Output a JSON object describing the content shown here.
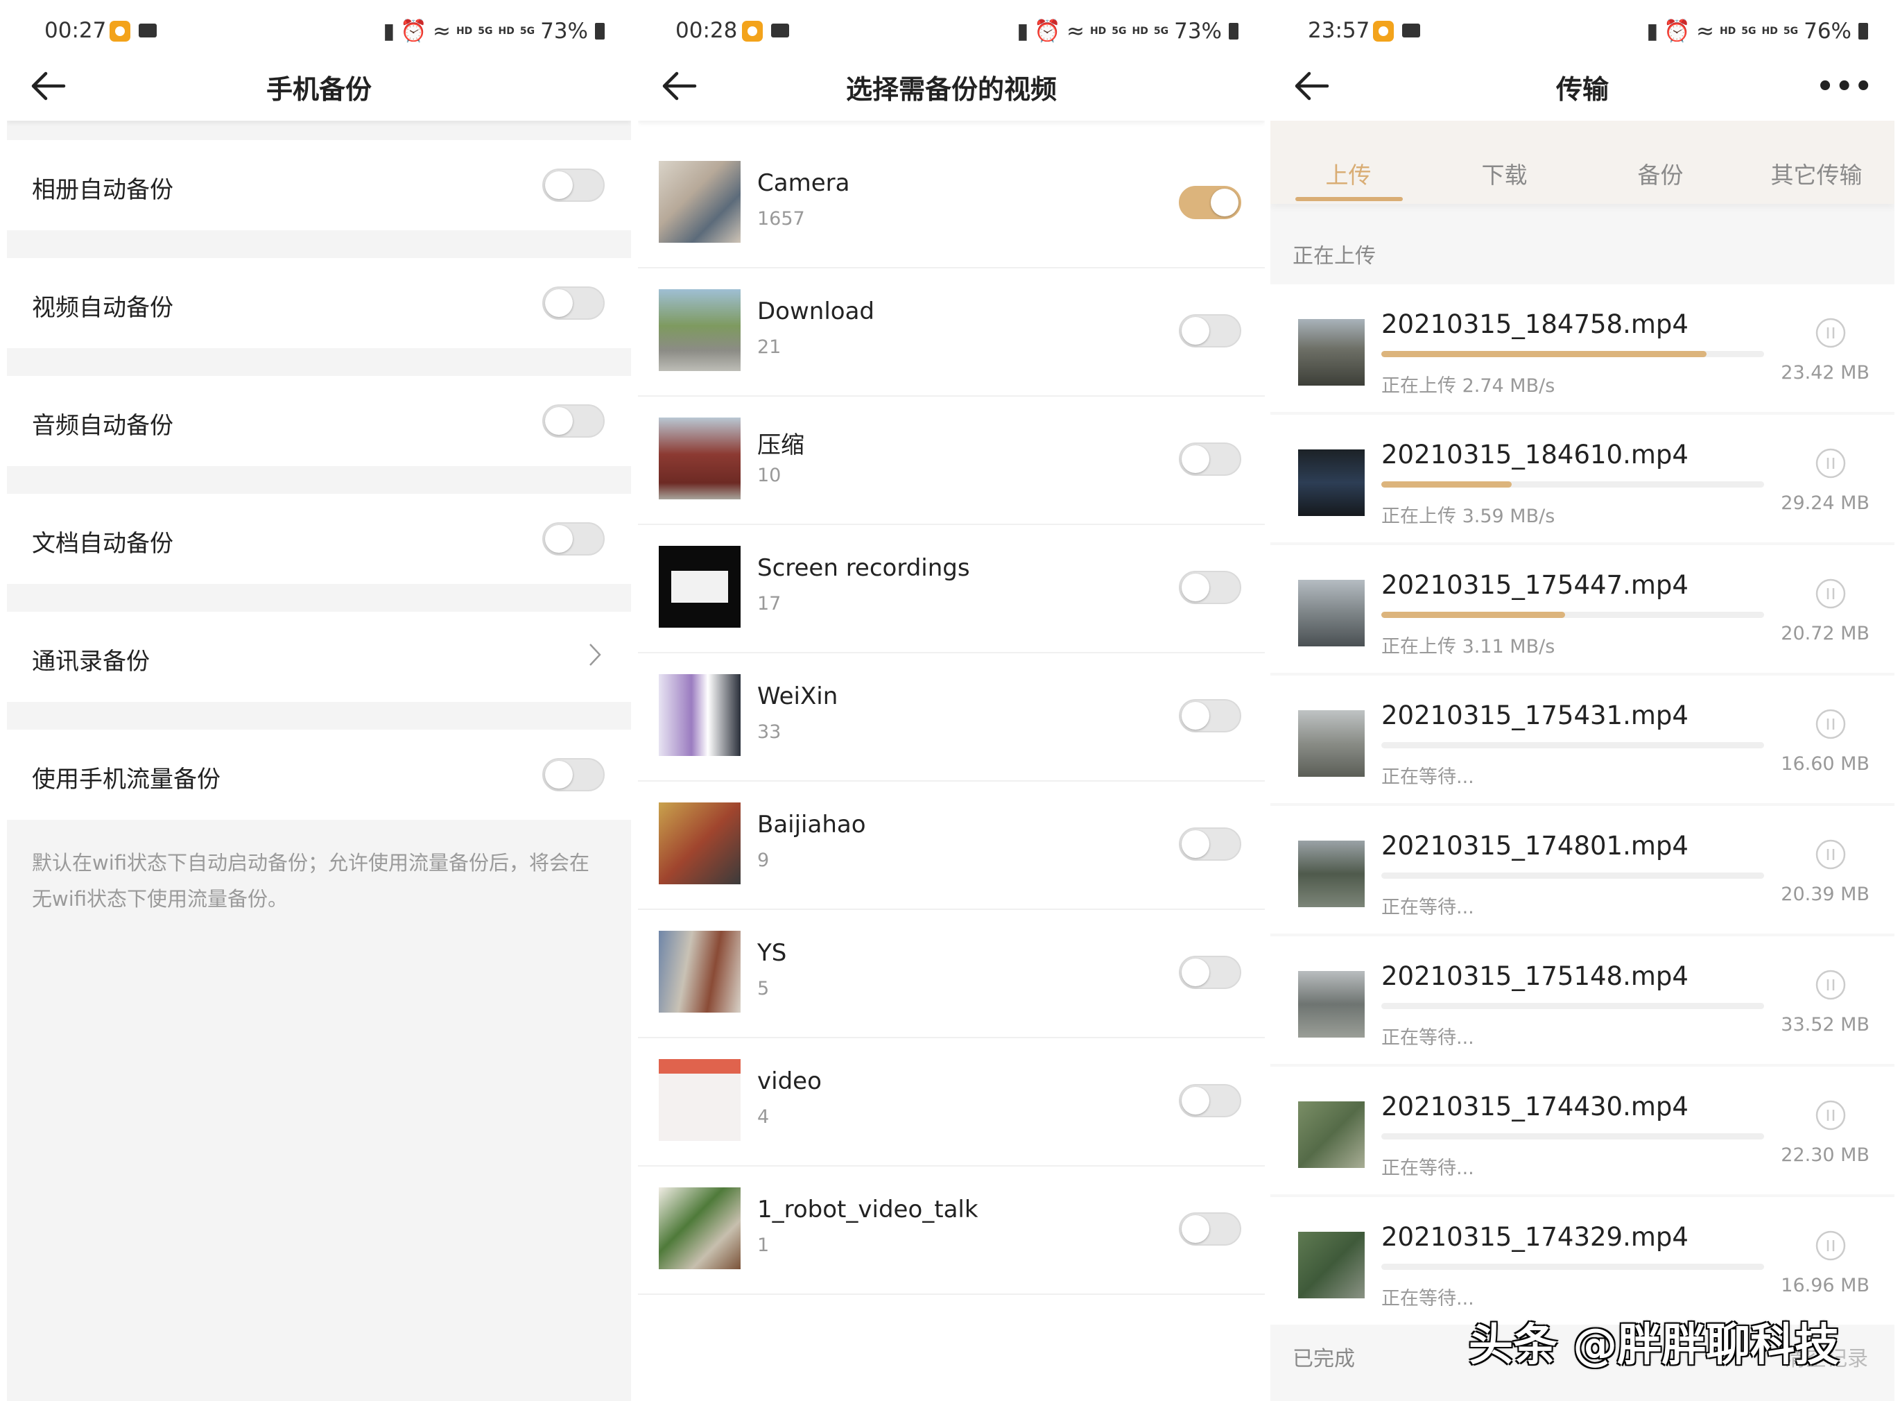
{
  "panel1": {
    "status": {
      "time": "00:27",
      "net1": "HD",
      "net1b": "5G",
      "net2": "HD",
      "net2b": "5G",
      "battery": "73%"
    },
    "title": "手机备份",
    "settings": [
      {
        "label": "相册自动备份",
        "type": "toggle",
        "on": false
      },
      {
        "label": "视频自动备份",
        "type": "toggle",
        "on": false
      },
      {
        "label": "音频自动备份",
        "type": "toggle",
        "on": false
      },
      {
        "label": "文档自动备份",
        "type": "toggle",
        "on": false
      },
      {
        "label": "通讯录备份",
        "type": "link"
      },
      {
        "label": "使用手机流量备份",
        "type": "toggle",
        "on": false
      }
    ],
    "note": "默认在wifi状态下自动启动备份；允许使用流量备份后，将会在无wifi状态下使用流量备份。"
  },
  "panel2": {
    "status": {
      "time": "00:28",
      "net1": "HD",
      "net1b": "5G",
      "net2": "HD",
      "net2b": "5G",
      "battery": "73%"
    },
    "title": "选择需备份的视频",
    "albums": [
      {
        "name": "Camera",
        "count": "1657",
        "on": true
      },
      {
        "name": "Download",
        "count": "21",
        "on": false
      },
      {
        "name": "压缩",
        "count": "10",
        "on": false
      },
      {
        "name": "Screen recordings",
        "count": "17",
        "on": false
      },
      {
        "name": "WeiXin",
        "count": "33",
        "on": false
      },
      {
        "name": "Baijiahao",
        "count": "9",
        "on": false
      },
      {
        "name": "YS",
        "count": "5",
        "on": false
      },
      {
        "name": "video",
        "count": "4",
        "on": false
      },
      {
        "name": "1_robot_video_talk",
        "count": "1",
        "on": false
      }
    ]
  },
  "panel3": {
    "status": {
      "time": "23:57",
      "net1": "HD",
      "net1b": "5G",
      "net2": "HD",
      "net2b": "5G",
      "battery": "76%"
    },
    "title": "传输",
    "more": "•••",
    "tabs": [
      "上传",
      "下载",
      "备份",
      "其它传输"
    ],
    "active_tab": 0,
    "uploading_label": "正在上传",
    "completed_label": "已完成",
    "clear_label": "清空记录",
    "uploads": [
      {
        "file": "20210315_184758.mp4",
        "status": "正在上传  2.74 MB/s",
        "size": "23.42 MB",
        "progress": 0.85
      },
      {
        "file": "20210315_184610.mp4",
        "status": "正在上传  3.59 MB/s",
        "size": "29.24 MB",
        "progress": 0.34
      },
      {
        "file": "20210315_175447.mp4",
        "status": "正在上传  3.11 MB/s",
        "size": "20.72 MB",
        "progress": 0.48
      },
      {
        "file": "20210315_175431.mp4",
        "status": "正在等待...",
        "size": "16.60 MB",
        "progress": 0
      },
      {
        "file": "20210315_174801.mp4",
        "status": "正在等待...",
        "size": "20.39 MB",
        "progress": 0
      },
      {
        "file": "20210315_175148.mp4",
        "status": "正在等待...",
        "size": "33.52 MB",
        "progress": 0
      },
      {
        "file": "20210315_174430.mp4",
        "status": "正在等待...",
        "size": "22.30 MB",
        "progress": 0
      },
      {
        "file": "20210315_174329.mp4",
        "status": "正在等待...",
        "size": "16.96 MB",
        "progress": 0
      }
    ]
  },
  "watermark": "头条 @胖胖聊科技",
  "colors": {
    "accent": "#dcb47c",
    "tab_active": "#d9ad74"
  }
}
